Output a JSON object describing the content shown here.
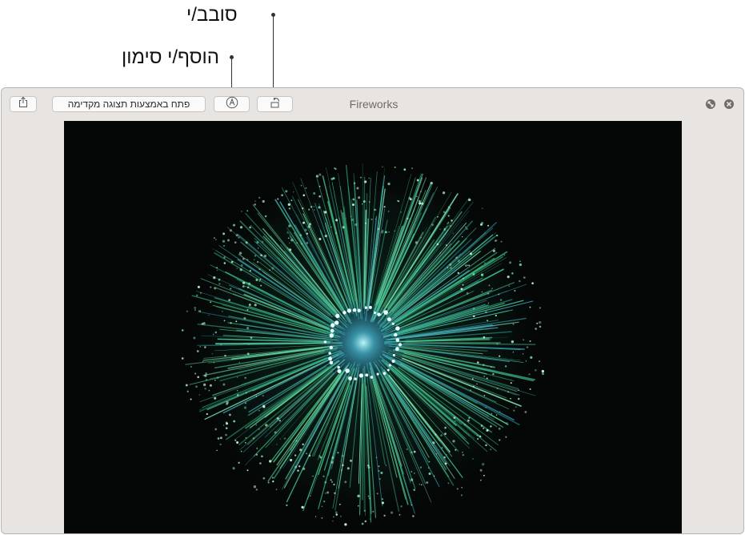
{
  "callouts": {
    "rotate": "סובב/י",
    "markup": "הוסף/י סימון"
  },
  "window": {
    "title": "Fireworks"
  },
  "toolbar": {
    "share_icon": "share-icon",
    "open_with_preview_label": "פתח באמצעות תצוגה מקדימה",
    "markup_icon": "markup-pen-icon",
    "rotate_icon": "rotate-left-icon"
  },
  "window_controls": {
    "fullscreen_icon": "fullscreen-icon",
    "close_icon": "close-icon"
  },
  "image": {
    "subject": "green fireworks burst",
    "colors": {
      "background": "#050707",
      "rays": "#3fbf84",
      "core": "#7fe8ff"
    }
  }
}
